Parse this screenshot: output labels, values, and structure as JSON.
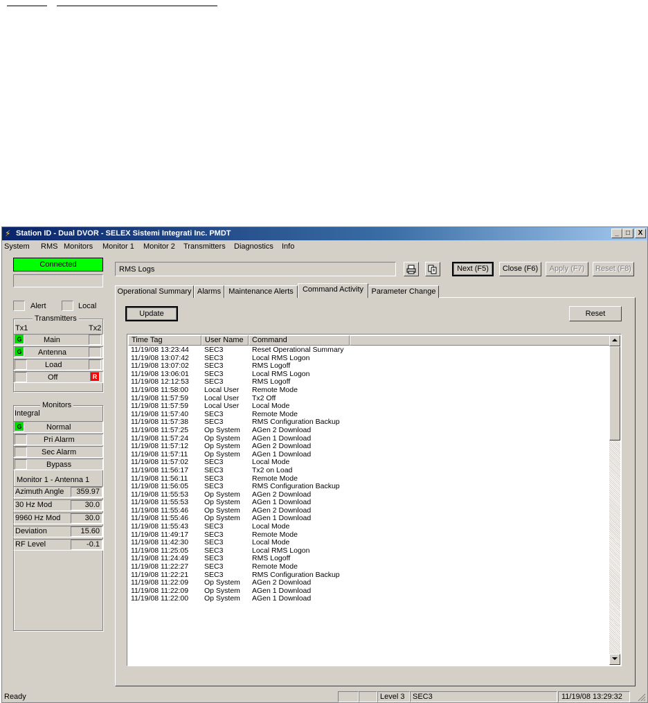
{
  "window": {
    "title": "Station ID - Dual DVOR - SELEX Sistemi Integrati Inc. PMDT",
    "minimize_label": "_",
    "maximize_label": "□",
    "close_label": "X"
  },
  "menu": [
    "System",
    "RMS",
    "Monitors",
    "Monitor 1",
    "Monitor 2",
    "Transmitters",
    "Diagnostics",
    "Info"
  ],
  "left": {
    "connection_status": "Connected",
    "alert_label": "Alert",
    "local_label": "Local",
    "transmitters": {
      "title": "Transmitters",
      "tx1": "Tx1",
      "tx2": "Tx2",
      "rows": [
        {
          "label": "Main",
          "left": "G",
          "right": ""
        },
        {
          "label": "Antenna",
          "left": "G",
          "right": ""
        },
        {
          "label": "Load",
          "left": "",
          "right": ""
        },
        {
          "label": "Off",
          "left": "",
          "right": "R"
        }
      ]
    },
    "monitors": {
      "title": "Monitors",
      "integral": "Integral",
      "rows": [
        {
          "label": "Normal",
          "led": "G"
        },
        {
          "label": "Pri Alarm",
          "led": ""
        },
        {
          "label": "Sec Alarm",
          "led": ""
        },
        {
          "label": "Bypass",
          "led": ""
        }
      ],
      "monitor_title": "Monitor 1 - Antenna 1",
      "values": [
        {
          "label": "Azimuth Angle",
          "value": "359.97"
        },
        {
          "label": "30 Hz Mod",
          "value": "30.0"
        },
        {
          "label": "9960 Hz Mod",
          "value": "30.0"
        },
        {
          "label": "Deviation",
          "value": "15.60"
        },
        {
          "label": "RF Level",
          "value": "-0.1"
        }
      ]
    }
  },
  "header": {
    "title": "RMS Logs",
    "next_label": "Next (F5)",
    "close_label": "Close (F6)",
    "apply_label": "Apply (F7)",
    "reset_label": "Reset (F8)"
  },
  "tabs": [
    "Operational Summary",
    "Alarms",
    "Maintenance Alerts",
    "Command Activity",
    "Parameter Change"
  ],
  "panel": {
    "update_label": "Update",
    "reset_label": "Reset",
    "columns": [
      "Time Tag",
      "User Name",
      "Command"
    ],
    "rows": [
      [
        "11/19/08 13:23:44",
        "SEC3",
        "Reset Operational Summary"
      ],
      [
        "11/19/08 13:07:42",
        "SEC3",
        "Local RMS Logon"
      ],
      [
        "11/19/08 13:07:02",
        "SEC3",
        "RMS Logoff"
      ],
      [
        "11/19/08 13:06:01",
        "SEC3",
        "Local RMS Logon"
      ],
      [
        "11/19/08 12:12:53",
        "SEC3",
        "RMS Logoff"
      ],
      [
        "11/19/08 11:58:00",
        "Local User",
        "Remote Mode"
      ],
      [
        "11/19/08 11:57:59",
        "Local User",
        "Tx2 Off"
      ],
      [
        "11/19/08 11:57:59",
        "Local User",
        "Local Mode"
      ],
      [
        "11/19/08 11:57:40",
        "SEC3",
        "Remote Mode"
      ],
      [
        "11/19/08 11:57:38",
        "SEC3",
        "RMS Configuration Backup"
      ],
      [
        "11/19/08 11:57:25",
        "Op System",
        "AGen 2 Download"
      ],
      [
        "11/19/08 11:57:24",
        "Op System",
        "AGen 1 Download"
      ],
      [
        "11/19/08 11:57:12",
        "Op System",
        "AGen 2 Download"
      ],
      [
        "11/19/08 11:57:11",
        "Op System",
        "AGen 1 Download"
      ],
      [
        "11/19/08 11:57:02",
        "SEC3",
        "Local Mode"
      ],
      [
        "11/19/08 11:56:17",
        "SEC3",
        "Tx2 on Load"
      ],
      [
        "11/19/08 11:56:11",
        "SEC3",
        "Remote Mode"
      ],
      [
        "11/19/08 11:56:05",
        "SEC3",
        "RMS Configuration Backup"
      ],
      [
        "11/19/08 11:55:53",
        "Op System",
        "AGen 2 Download"
      ],
      [
        "11/19/08 11:55:53",
        "Op System",
        "AGen 1 Download"
      ],
      [
        "11/19/08 11:55:46",
        "Op System",
        "AGen 2 Download"
      ],
      [
        "11/19/08 11:55:46",
        "Op System",
        "AGen 1 Download"
      ],
      [
        "11/19/08 11:55:43",
        "SEC3",
        "Local Mode"
      ],
      [
        "11/19/08 11:49:17",
        "SEC3",
        "Remote Mode"
      ],
      [
        "11/19/08 11:42:30",
        "SEC3",
        "Local Mode"
      ],
      [
        "11/19/08 11:25:05",
        "SEC3",
        "Local RMS Logon"
      ],
      [
        "11/19/08 11:24:49",
        "SEC3",
        "RMS Logoff"
      ],
      [
        "11/19/08 11:22:27",
        "SEC3",
        "Remote Mode"
      ],
      [
        "11/19/08 11:22:21",
        "SEC3",
        "RMS Configuration Backup"
      ],
      [
        "11/19/08 11:22:09",
        "Op System",
        "AGen 2 Download"
      ],
      [
        "11/19/08 11:22:09",
        "Op System",
        "AGen 1 Download"
      ],
      [
        "11/19/08 11:22:00",
        "Op System",
        "AGen 1 Download"
      ]
    ]
  },
  "status": {
    "ready": "Ready",
    "level": "Level 3",
    "user": "SEC3",
    "datetime": "11/19/08 13:29:32"
  },
  "icons": {
    "app": "lightning-icon",
    "print": "printer-icon",
    "copy": "copy-icon",
    "grip": "resize-grip-icon"
  }
}
